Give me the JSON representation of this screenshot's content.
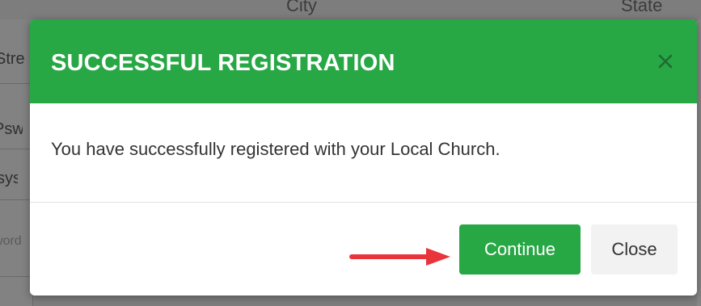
{
  "background": {
    "columns": [
      "City",
      "State"
    ],
    "left_cells": [
      {
        "text": "Stre",
        "placeholder": false
      },
      {
        "text": "Pswd",
        "placeholder": false
      },
      {
        "text": "ssyse",
        "placeholder": false
      },
      {
        "text": "word",
        "placeholder": true
      }
    ]
  },
  "modal": {
    "title": "SUCCESSFUL REGISTRATION",
    "close_icon": "close-icon",
    "message": "You have successfully registered with your Local Church.",
    "buttons": {
      "continue_label": "Continue",
      "close_label": "Close"
    }
  },
  "colors": {
    "header_green": "#28a745",
    "button_green": "#28a745",
    "arrow_red": "#e8353b",
    "close_button_bg": "#f2f2f2"
  }
}
